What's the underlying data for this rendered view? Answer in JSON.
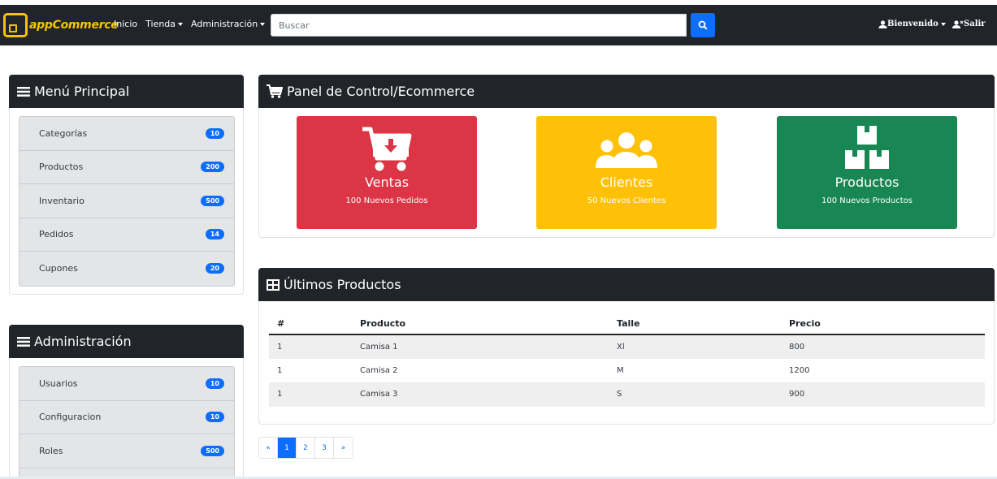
{
  "navbar": {
    "brand": "appCommerce",
    "links": [
      {
        "label": "Inicio"
      },
      {
        "label": "Tienda"
      },
      {
        "label": "Administración"
      }
    ],
    "search_placeholder": "Buscar",
    "welcome": "Bienvenido",
    "logout": "Salir"
  },
  "sidebar": {
    "main_menu": {
      "title": "Menú Principal",
      "items": [
        {
          "label": "Categorías",
          "count": "10"
        },
        {
          "label": "Productos",
          "count": "200"
        },
        {
          "label": "Inventario",
          "count": "500"
        },
        {
          "label": "Pedidos",
          "count": "14"
        },
        {
          "label": "Cupones",
          "count": "20"
        }
      ]
    },
    "admin_menu": {
      "title": "Administración",
      "items": [
        {
          "label": "Usuarios",
          "count": "10"
        },
        {
          "label": "Configuracion",
          "count": "10"
        },
        {
          "label": "Roles",
          "count": "500"
        }
      ]
    }
  },
  "dashboard": {
    "title": "Panel de Control/Ecommerce",
    "tiles": [
      {
        "title": "Ventas",
        "subtitle": "100 Nuevos Pedidos",
        "color": "#dc3545",
        "icon": "cart-download-icon"
      },
      {
        "title": "Clientes",
        "subtitle": "50 Nuevos Clientes",
        "color": "#ffc107",
        "icon": "users-icon"
      },
      {
        "title": "Productos",
        "subtitle": "100 Nuevos Productos",
        "color": "#198754",
        "icon": "boxes-icon"
      }
    ]
  },
  "products": {
    "title": "Últimos Productos",
    "columns": [
      "#",
      "Producto",
      "Talle",
      "Precio"
    ],
    "rows": [
      [
        "1",
        "Camisa 1",
        "Xl",
        "800"
      ],
      [
        "1",
        "Camisa 2",
        "M",
        "1200"
      ],
      [
        "1",
        "Camisa 3",
        "S",
        "900"
      ]
    ]
  },
  "pagination": [
    "«",
    "1",
    "2",
    "3",
    "»"
  ],
  "pagination_active": "1",
  "colors": {
    "navbar": "#212529",
    "primary": "#0d6efd",
    "brand": "#f5c400"
  }
}
